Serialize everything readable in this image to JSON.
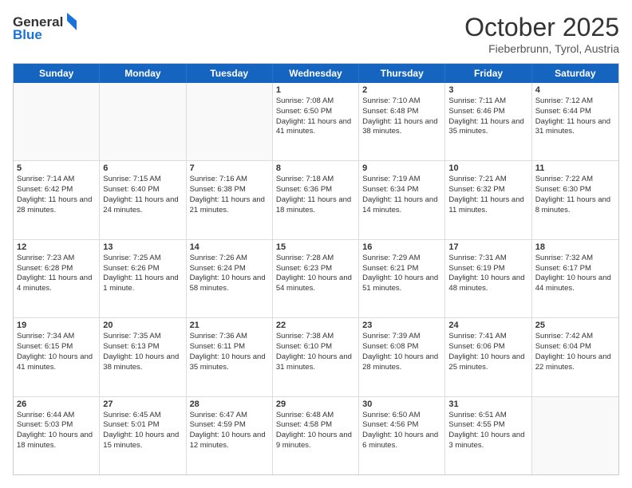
{
  "header": {
    "logo_general": "General",
    "logo_blue": "Blue",
    "title": "October 2025",
    "location": "Fieberbrunn, Tyrol, Austria"
  },
  "weekdays": [
    "Sunday",
    "Monday",
    "Tuesday",
    "Wednesday",
    "Thursday",
    "Friday",
    "Saturday"
  ],
  "rows": [
    [
      {
        "day": "",
        "sunrise": "",
        "sunset": "",
        "daylight": "",
        "empty": true
      },
      {
        "day": "",
        "sunrise": "",
        "sunset": "",
        "daylight": "",
        "empty": true
      },
      {
        "day": "",
        "sunrise": "",
        "sunset": "",
        "daylight": "",
        "empty": true
      },
      {
        "day": "1",
        "sunrise": "Sunrise: 7:08 AM",
        "sunset": "Sunset: 6:50 PM",
        "daylight": "Daylight: 11 hours and 41 minutes."
      },
      {
        "day": "2",
        "sunrise": "Sunrise: 7:10 AM",
        "sunset": "Sunset: 6:48 PM",
        "daylight": "Daylight: 11 hours and 38 minutes."
      },
      {
        "day": "3",
        "sunrise": "Sunrise: 7:11 AM",
        "sunset": "Sunset: 6:46 PM",
        "daylight": "Daylight: 11 hours and 35 minutes."
      },
      {
        "day": "4",
        "sunrise": "Sunrise: 7:12 AM",
        "sunset": "Sunset: 6:44 PM",
        "daylight": "Daylight: 11 hours and 31 minutes."
      }
    ],
    [
      {
        "day": "5",
        "sunrise": "Sunrise: 7:14 AM",
        "sunset": "Sunset: 6:42 PM",
        "daylight": "Daylight: 11 hours and 28 minutes."
      },
      {
        "day": "6",
        "sunrise": "Sunrise: 7:15 AM",
        "sunset": "Sunset: 6:40 PM",
        "daylight": "Daylight: 11 hours and 24 minutes."
      },
      {
        "day": "7",
        "sunrise": "Sunrise: 7:16 AM",
        "sunset": "Sunset: 6:38 PM",
        "daylight": "Daylight: 11 hours and 21 minutes."
      },
      {
        "day": "8",
        "sunrise": "Sunrise: 7:18 AM",
        "sunset": "Sunset: 6:36 PM",
        "daylight": "Daylight: 11 hours and 18 minutes."
      },
      {
        "day": "9",
        "sunrise": "Sunrise: 7:19 AM",
        "sunset": "Sunset: 6:34 PM",
        "daylight": "Daylight: 11 hours and 14 minutes."
      },
      {
        "day": "10",
        "sunrise": "Sunrise: 7:21 AM",
        "sunset": "Sunset: 6:32 PM",
        "daylight": "Daylight: 11 hours and 11 minutes."
      },
      {
        "day": "11",
        "sunrise": "Sunrise: 7:22 AM",
        "sunset": "Sunset: 6:30 PM",
        "daylight": "Daylight: 11 hours and 8 minutes."
      }
    ],
    [
      {
        "day": "12",
        "sunrise": "Sunrise: 7:23 AM",
        "sunset": "Sunset: 6:28 PM",
        "daylight": "Daylight: 11 hours and 4 minutes."
      },
      {
        "day": "13",
        "sunrise": "Sunrise: 7:25 AM",
        "sunset": "Sunset: 6:26 PM",
        "daylight": "Daylight: 11 hours and 1 minute."
      },
      {
        "day": "14",
        "sunrise": "Sunrise: 7:26 AM",
        "sunset": "Sunset: 6:24 PM",
        "daylight": "Daylight: 10 hours and 58 minutes."
      },
      {
        "day": "15",
        "sunrise": "Sunrise: 7:28 AM",
        "sunset": "Sunset: 6:23 PM",
        "daylight": "Daylight: 10 hours and 54 minutes."
      },
      {
        "day": "16",
        "sunrise": "Sunrise: 7:29 AM",
        "sunset": "Sunset: 6:21 PM",
        "daylight": "Daylight: 10 hours and 51 minutes."
      },
      {
        "day": "17",
        "sunrise": "Sunrise: 7:31 AM",
        "sunset": "Sunset: 6:19 PM",
        "daylight": "Daylight: 10 hours and 48 minutes."
      },
      {
        "day": "18",
        "sunrise": "Sunrise: 7:32 AM",
        "sunset": "Sunset: 6:17 PM",
        "daylight": "Daylight: 10 hours and 44 minutes."
      }
    ],
    [
      {
        "day": "19",
        "sunrise": "Sunrise: 7:34 AM",
        "sunset": "Sunset: 6:15 PM",
        "daylight": "Daylight: 10 hours and 41 minutes."
      },
      {
        "day": "20",
        "sunrise": "Sunrise: 7:35 AM",
        "sunset": "Sunset: 6:13 PM",
        "daylight": "Daylight: 10 hours and 38 minutes."
      },
      {
        "day": "21",
        "sunrise": "Sunrise: 7:36 AM",
        "sunset": "Sunset: 6:11 PM",
        "daylight": "Daylight: 10 hours and 35 minutes."
      },
      {
        "day": "22",
        "sunrise": "Sunrise: 7:38 AM",
        "sunset": "Sunset: 6:10 PM",
        "daylight": "Daylight: 10 hours and 31 minutes."
      },
      {
        "day": "23",
        "sunrise": "Sunrise: 7:39 AM",
        "sunset": "Sunset: 6:08 PM",
        "daylight": "Daylight: 10 hours and 28 minutes."
      },
      {
        "day": "24",
        "sunrise": "Sunrise: 7:41 AM",
        "sunset": "Sunset: 6:06 PM",
        "daylight": "Daylight: 10 hours and 25 minutes."
      },
      {
        "day": "25",
        "sunrise": "Sunrise: 7:42 AM",
        "sunset": "Sunset: 6:04 PM",
        "daylight": "Daylight: 10 hours and 22 minutes."
      }
    ],
    [
      {
        "day": "26",
        "sunrise": "Sunrise: 6:44 AM",
        "sunset": "Sunset: 5:03 PM",
        "daylight": "Daylight: 10 hours and 18 minutes."
      },
      {
        "day": "27",
        "sunrise": "Sunrise: 6:45 AM",
        "sunset": "Sunset: 5:01 PM",
        "daylight": "Daylight: 10 hours and 15 minutes."
      },
      {
        "day": "28",
        "sunrise": "Sunrise: 6:47 AM",
        "sunset": "Sunset: 4:59 PM",
        "daylight": "Daylight: 10 hours and 12 minutes."
      },
      {
        "day": "29",
        "sunrise": "Sunrise: 6:48 AM",
        "sunset": "Sunset: 4:58 PM",
        "daylight": "Daylight: 10 hours and 9 minutes."
      },
      {
        "day": "30",
        "sunrise": "Sunrise: 6:50 AM",
        "sunset": "Sunset: 4:56 PM",
        "daylight": "Daylight: 10 hours and 6 minutes."
      },
      {
        "day": "31",
        "sunrise": "Sunrise: 6:51 AM",
        "sunset": "Sunset: 4:55 PM",
        "daylight": "Daylight: 10 hours and 3 minutes."
      },
      {
        "day": "",
        "sunrise": "",
        "sunset": "",
        "daylight": "",
        "empty": true
      }
    ]
  ]
}
